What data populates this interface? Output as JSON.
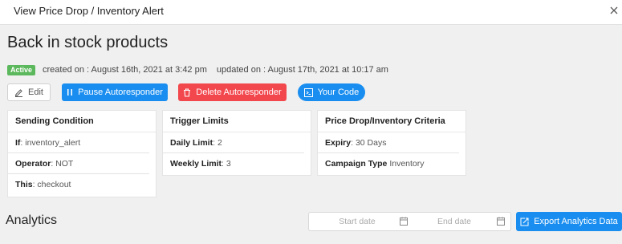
{
  "window": {
    "title": "View Price Drop / Inventory Alert",
    "close_icon": "close-icon"
  },
  "page": {
    "heading": "Back in stock products",
    "status_badge": "Active",
    "created": "created on : August 16th, 2021 at 3:42 pm",
    "updated": "updated on : August 17th, 2021 at 10:17 am"
  },
  "actions": {
    "edit": "Edit",
    "pause": "Pause Autoresponder",
    "delete": "Delete Autoresponder",
    "code": "Your Code"
  },
  "cards": {
    "sending": {
      "title": "Sending Condition",
      "rows": [
        {
          "key": "If",
          "value": ": inventory_alert"
        },
        {
          "key": "Operator",
          "value": ": NOT"
        },
        {
          "key": "This",
          "value": ": checkout"
        }
      ]
    },
    "trigger": {
      "title": "Trigger Limits",
      "rows": [
        {
          "key": "Daily Limit",
          "value": ": 2"
        },
        {
          "key": "Weekly Limit",
          "value": ": 3"
        }
      ]
    },
    "criteria": {
      "title": "Price Drop/Inventory Criteria",
      "rows": [
        {
          "key": "Expiry",
          "value": ": 30 Days"
        },
        {
          "key": "Campaign Type",
          "value": " Inventory"
        }
      ]
    }
  },
  "analytics": {
    "title": "Analytics",
    "start_placeholder": "Start date",
    "end_placeholder": "End date",
    "export": "Export Analytics Data"
  },
  "colors": {
    "primary": "#1a8ef0",
    "danger": "#f2474d",
    "success": "#5cb85c"
  }
}
